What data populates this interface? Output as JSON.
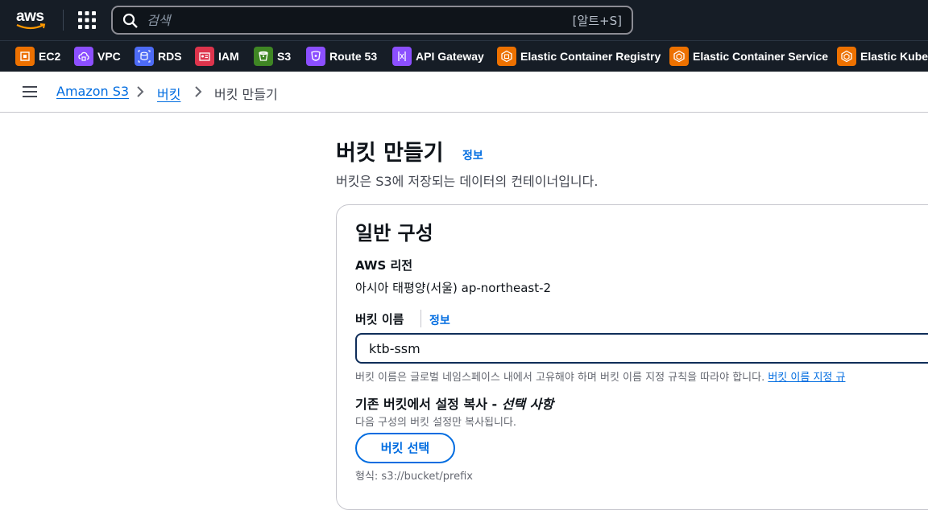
{
  "topnav": {
    "logo_text": "aws",
    "search_placeholder": "검색",
    "search_shortcut": "[알트+S]"
  },
  "favorites": [
    {
      "label": "EC2",
      "color": "#ed7100",
      "icon": "ec2-icon"
    },
    {
      "label": "VPC",
      "color": "#8c4fff",
      "icon": "vpc-icon"
    },
    {
      "label": "RDS",
      "color": "#4d6bf5",
      "icon": "rds-icon"
    },
    {
      "label": "IAM",
      "color": "#dd344c",
      "icon": "iam-icon"
    },
    {
      "label": "S3",
      "color": "#3f8624",
      "icon": "s3-icon"
    },
    {
      "label": "Route 53",
      "color": "#8c4fff",
      "icon": "route53-icon"
    },
    {
      "label": "API Gateway",
      "color": "#8c4fff",
      "icon": "api-gateway-icon"
    },
    {
      "label": "Elastic Container Registry",
      "color": "#ed7100",
      "icon": "ecr-icon"
    },
    {
      "label": "Elastic Container Service",
      "color": "#ed7100",
      "icon": "ecs-icon"
    },
    {
      "label": "Elastic Kuber",
      "color": "#ed7100",
      "icon": "eks-icon"
    }
  ],
  "breadcrumb": {
    "items": [
      "Amazon S3",
      "버킷",
      "버킷 만들기"
    ]
  },
  "header": {
    "title": "버킷 만들기",
    "info": "정보",
    "description": "버킷은 S3에 저장되는 데이터의 컨테이너입니다."
  },
  "general": {
    "title": "일반 구성",
    "region_label": "AWS 리전",
    "region_value": "아시아 태평양(서울) ap-northeast-2",
    "bucket_name_label": "버킷 이름",
    "bucket_name_info": "정보",
    "bucket_name_value": "ktb-ssm",
    "constraint_text": "버킷 이름은 글로벌 네임스페이스 내에서 고유해야 하며 버킷 이름 지정 규칙을 따라야 합니다. ",
    "constraint_link": "버킷 이름 지정 규",
    "copy_title": "기존 버킷에서 설정 복사 - ",
    "copy_optional": "선택 사항",
    "copy_desc": "다음 구성의 버킷 설정만 복사됩니다.",
    "select_button": "버킷 선택",
    "format_hint": "형식: s3://bucket/prefix"
  }
}
